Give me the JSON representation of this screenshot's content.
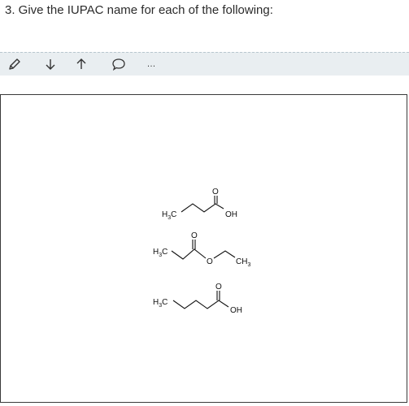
{
  "question": {
    "text": "3. Give the IUPAC name for each of the following:"
  },
  "toolbar": {
    "icons": [
      "pencil-icon",
      "arrow-down-icon",
      "arrow-up-icon",
      "comment-icon",
      "more-icon"
    ],
    "more_label": "…"
  },
  "molecules": {
    "m1": {
      "h3c": "H",
      "h3c_sub": "3",
      "h3c_c": "C",
      "oxygen": "O",
      "oh": "OH"
    },
    "m2": {
      "h3c": "H",
      "h3c_sub": "3",
      "h3c_c": "C",
      "oxygen_carbonyl": "O",
      "oxygen_ester": "O",
      "ch3": "CH",
      "ch3_sub": "3"
    },
    "m3": {
      "h3c": "H",
      "h3c_sub": "3",
      "h3c_c": "C",
      "oxygen": "O",
      "oh": "OH"
    }
  }
}
